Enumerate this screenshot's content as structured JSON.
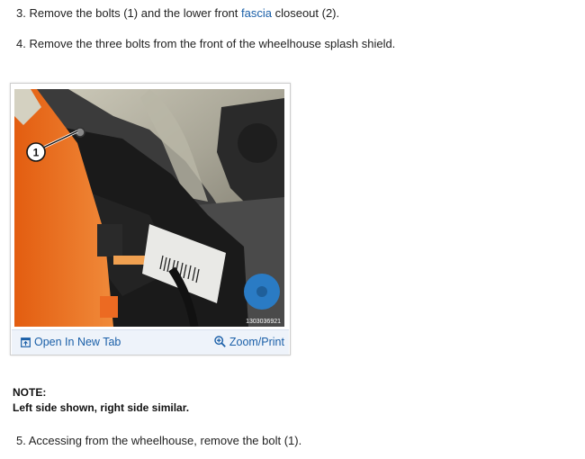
{
  "steps": {
    "step3": {
      "prefix": "3. Remove the bolts (1) and the lower front ",
      "link": "fascia",
      "suffix": " closeout (2)."
    },
    "step4": {
      "text": "4. Remove the three bolts from the front of the wheelhouse splash shield."
    },
    "step5": {
      "text": "5. Accessing from the wheelhouse, remove the bolt (1)."
    }
  },
  "figure": {
    "callout": "1",
    "image_id": "1303036921",
    "open_label": "Open In New Tab",
    "zoom_label": "Zoom/Print",
    "open_icon": "open-in-new-tab-icon",
    "zoom_icon": "magnifier-plus-icon"
  },
  "note": {
    "title": "NOTE:",
    "body": "Left side shown, right side similar."
  },
  "colors": {
    "link": "#1a5fa8",
    "bar": "#eef3fa"
  }
}
